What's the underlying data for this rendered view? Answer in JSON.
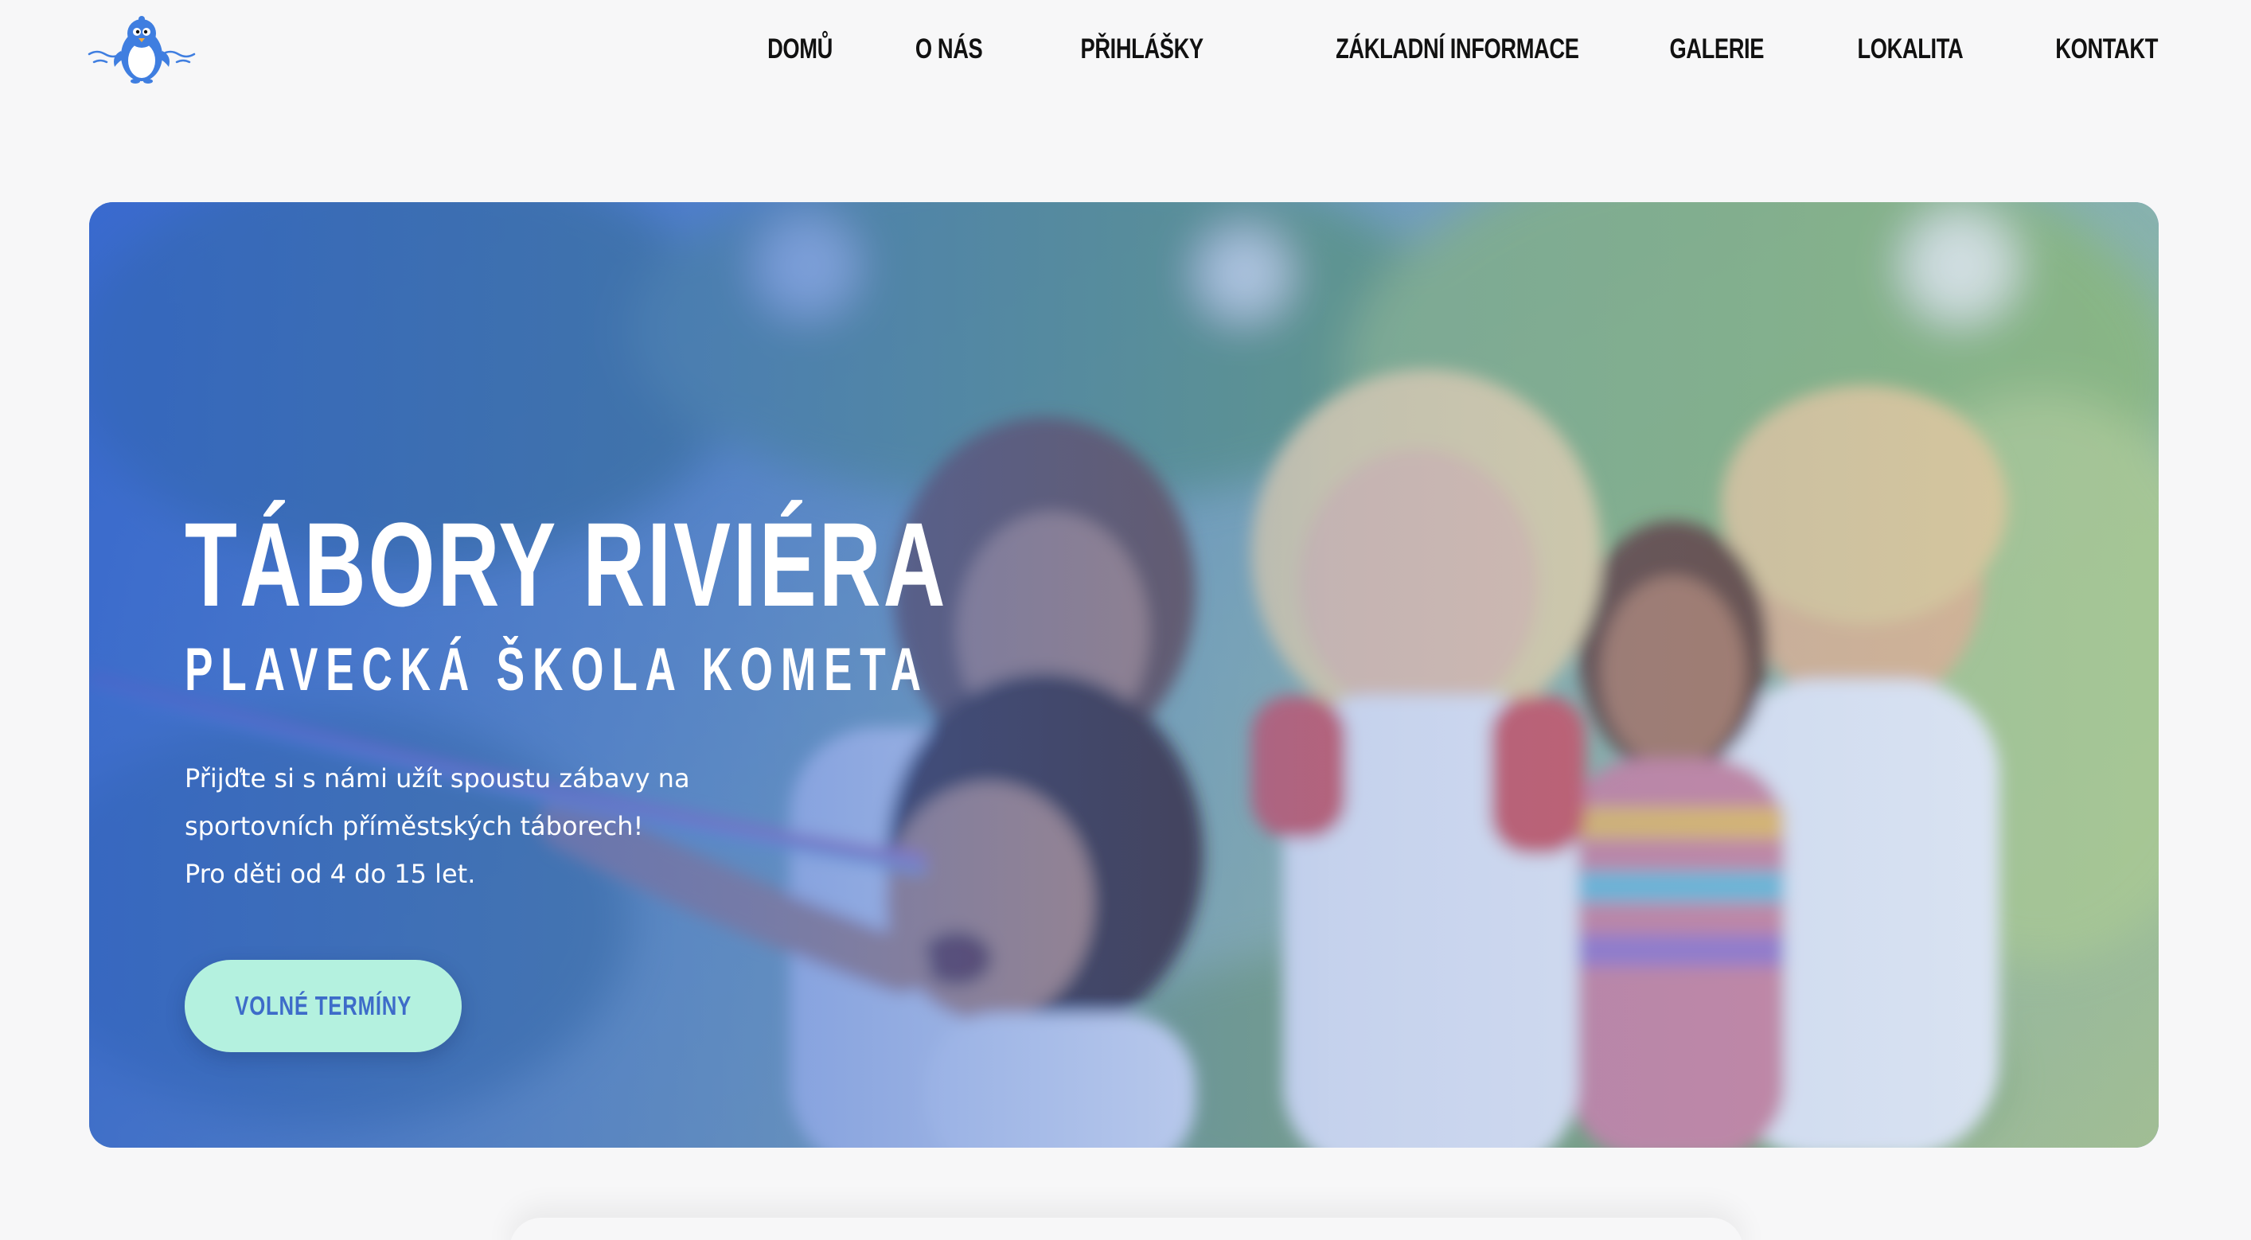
{
  "header": {
    "logo_icon": "penguin-icon",
    "nav": [
      {
        "label": "DOMŮ"
      },
      {
        "label": "O NÁS"
      },
      {
        "label": "PŘIHLÁŠKY"
      },
      {
        "label": "ZÁKLADNÍ INFORMACE"
      },
      {
        "label": "GALERIE"
      },
      {
        "label": "LOKALITA"
      },
      {
        "label": "KONTAKT"
      }
    ]
  },
  "hero": {
    "title": "TÁBORY RIVIÉRA",
    "subtitle": "PLAVECKÁ ŠKOLA KOMETA",
    "text_lines": [
      "Přijďte si s námi užít spoustu zábavy na",
      "sportovních příměstských táborech!",
      "Pro děti od 4 do 15 let."
    ],
    "cta_label": "VOLNÉ TERMÍNY"
  },
  "colors": {
    "page_bg": "#f7f7f8",
    "hero_overlay": "#3363ce",
    "cta_bg": "#b4f1df",
    "cta_text": "#3d6cc9",
    "nav_text": "#111111",
    "logo_blue": "#3f7ee0"
  }
}
